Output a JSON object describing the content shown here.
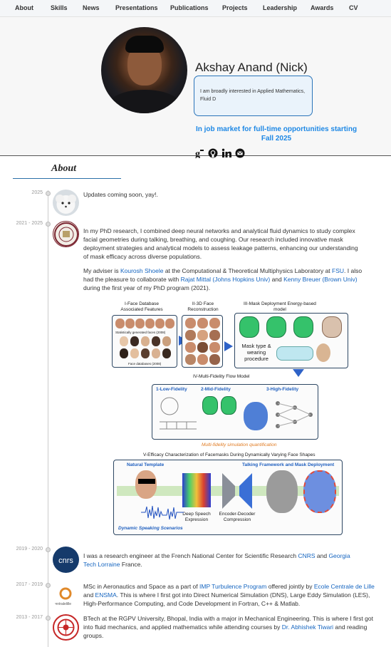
{
  "nav": {
    "items": [
      "About",
      "Skills",
      "News",
      "Presentations",
      "Publications",
      "Projects",
      "Leadership",
      "Awards",
      "CV"
    ]
  },
  "profile": {
    "name": "Akshay Anand (Nick)",
    "bio": "I am broadly interested in Applied Mathematics, Fluid D",
    "job_market": "In job market for full-time opportunities starting Fall 2025",
    "social_icons": [
      "google-scholar-icon",
      "github-icon",
      "linkedin-icon",
      "email-icon"
    ]
  },
  "about": {
    "heading": "About",
    "timeline": [
      {
        "date": "2025",
        "logo": "puppy-photo",
        "text": "Updates coming soon, yay!."
      },
      {
        "date": "2021 - 2025",
        "logo": "fsu-seal",
        "p1": "In my PhD research, I combined deep neural networks and analytical fluid dynamics to study complex facial geometries during talking, breathing, and coughing. Our research included innovative mask deployment strategies and analytical models to assess leakage patterns, enhancing our understanding of mask efficacy across diverse populations.",
        "p2_a": "My adviser is ",
        "p2_link1": "Kourosh Shoele",
        "p2_b": " at the Computational & Theoretical Multiphysics Laboratory at ",
        "p2_link2": "FSU",
        "p2_c": ". I also had the pleasure to collaborate with ",
        "p2_link3": "Rajat Mittal (Johns Hopkins Univ)",
        "p2_d": " and ",
        "p2_link4": "Kenny Breuer (Brown Univ)",
        "p2_e": " during the first year of my PhD program (2021)."
      },
      {
        "date": "2019 - 2020",
        "logo": "cnrs-logo",
        "a": "I was a research engineer at the French National Center for Scientific Research ",
        "link1": "CNRS",
        "b": " and ",
        "link2": "Georgia Tech Lorraine",
        "c": " France."
      },
      {
        "date": "2017 - 2019",
        "logo": "centrale-lille-logo",
        "logo_text": "centralelille",
        "a": "MSc in Aeronautics and Space as a part of ",
        "link1": "IMP Turbulence Program",
        "b": " offered jointly by ",
        "link2": "Ecole Centrale de Lille",
        "c": " and ",
        "link3": "ENSMA",
        "d": ". This is where I first got into Direct Numerical Simulation (DNS), Large Eddy Simulation (LES), High-Performance Computing, and Code Development in Fortran, C++ & Matlab."
      },
      {
        "date": "2013 - 2017",
        "logo": "rgpv-logo",
        "a": "BTech at the RGPV University, Bhopal, India with a major in Mechanical Engineering. This is where I first got into fluid mechanics, and applied mathematics while attending courses by ",
        "link1": "Dr. Abhishek Tiwari",
        "b": " and reading groups."
      }
    ]
  },
  "figure": {
    "p1_title": "I-Face Database Associated Features",
    "p1_sub1": "Statistically generated faces (2008)",
    "p1_sub2": "Face databases (2008)",
    "p2_title": "II-3D Face Reconstruction",
    "p3_title": "III-Mask Deployment Energy-based model",
    "p3_mask": "Mask type & wearing procedure",
    "p4_title": "IV-Multi-Fidelity  Flow Model",
    "low": "1-Low-Fidelity",
    "mid": "2-Mid-Fidelity",
    "high": "3-High-Fidelity",
    "mf": "Multi-fidelity simulation quantification",
    "p5_title": "V-Efficacy Characterization of Facemasks During Dynamically Varying Face Shapes",
    "natural": "Natural Template",
    "talking": "Talking Framework and Mask Deployment",
    "deep": "Deep Speech Expression",
    "enc": "Encoder-Decoder Compression",
    "dyn": "Dynamic Speaking Scenarios",
    "colors": {
      "accent": "#2e62c7",
      "green": "#35c26b",
      "orange": "#e07a20",
      "link": "#1565c0"
    }
  }
}
